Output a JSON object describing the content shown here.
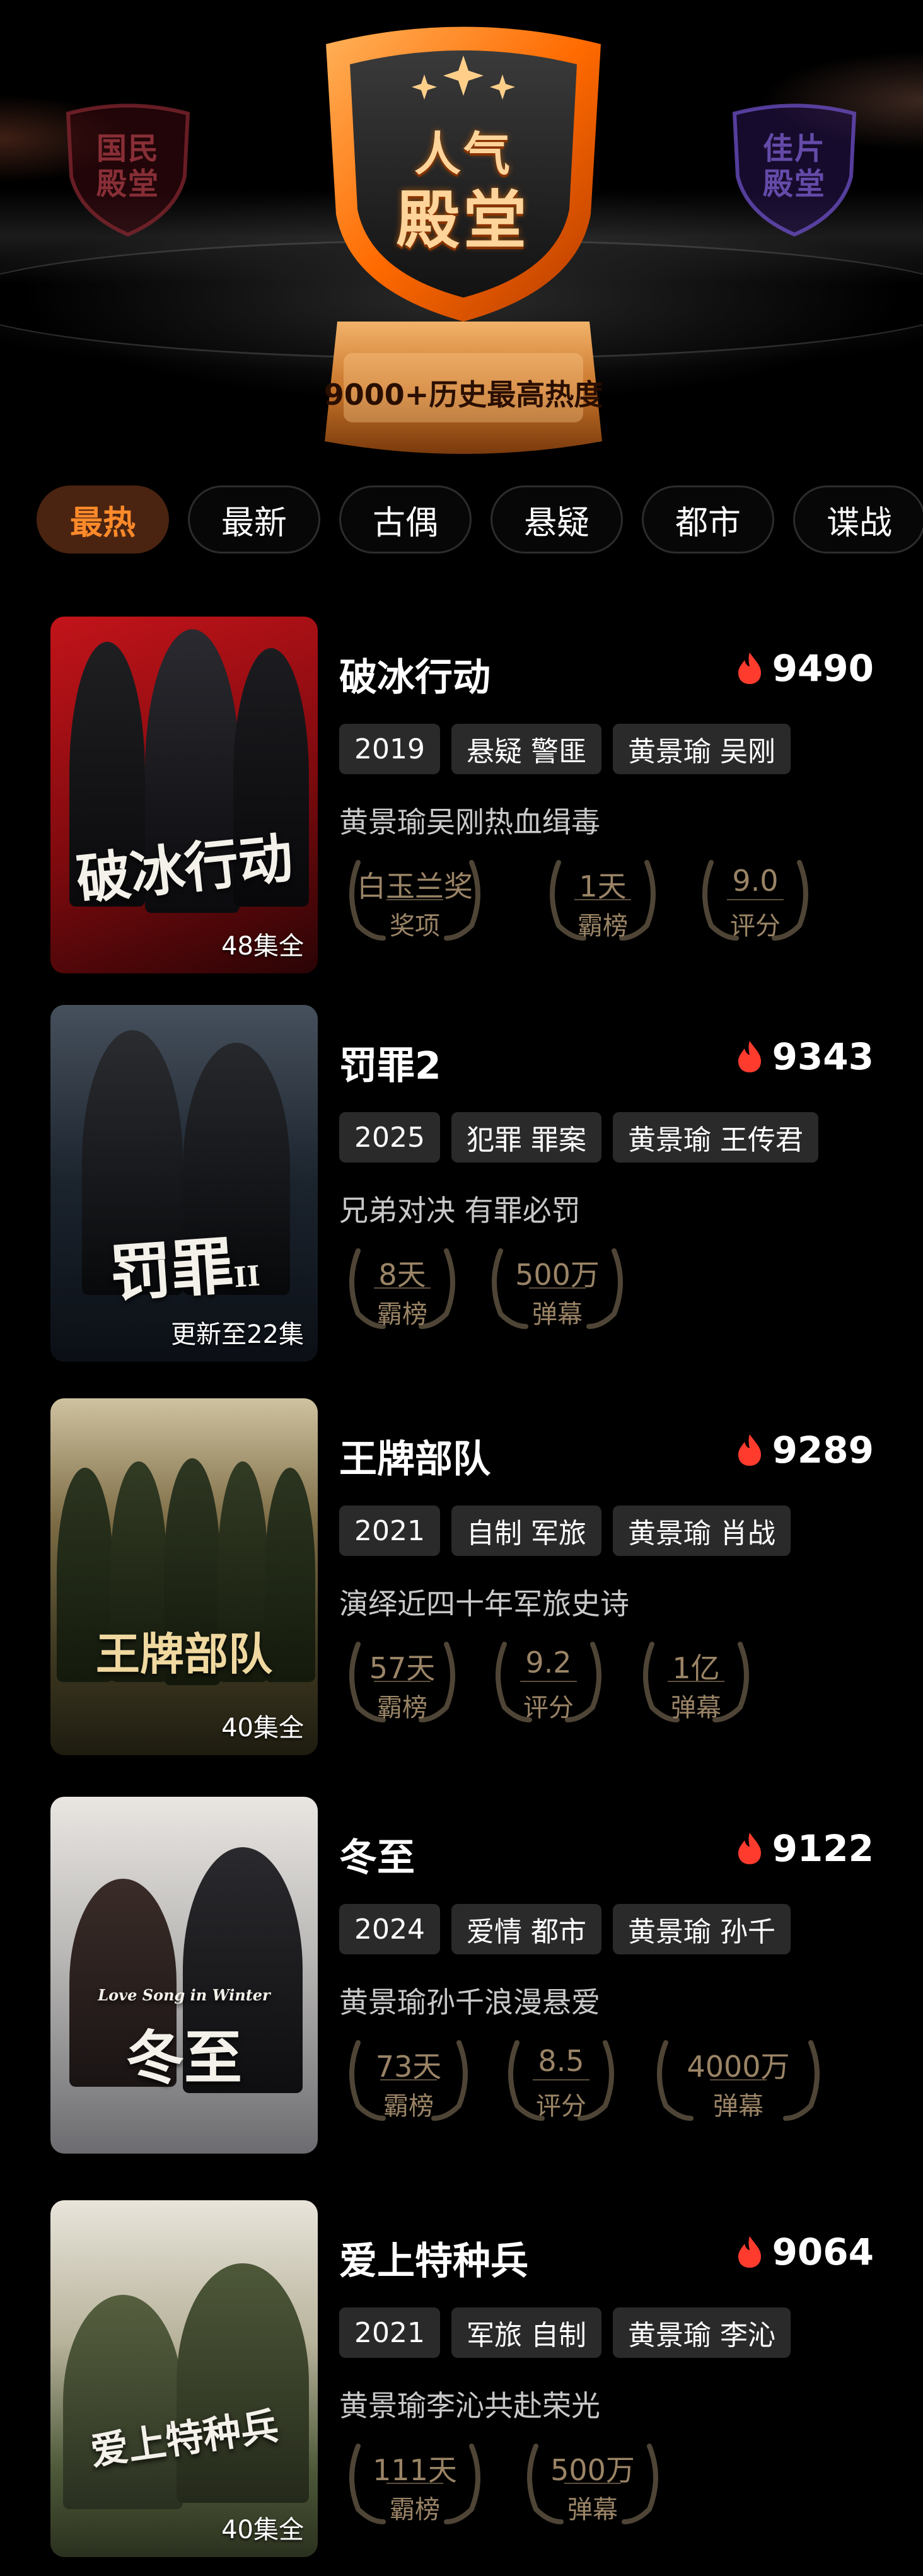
{
  "header": {
    "left_badge_text": [
      "国民",
      "殿堂"
    ],
    "main_badge_line1": "人气",
    "main_badge_line2": "殿堂",
    "main_badge_subtitle": "9000+历史最高热度",
    "right_badge_text": [
      "佳片",
      "殿堂"
    ],
    "accent_color": "#ff8a2a"
  },
  "tabs": [
    {
      "label": "最热",
      "active": true
    },
    {
      "label": "最新",
      "active": false
    },
    {
      "label": "古偶",
      "active": false
    },
    {
      "label": "悬疑",
      "active": false
    },
    {
      "label": "都市",
      "active": false
    },
    {
      "label": "谍战",
      "active": false
    }
  ],
  "shows": [
    {
      "title": "破冰行动",
      "heat": "9490",
      "poster_title": "破冰行动",
      "episodes": "48集全",
      "tags": [
        "2019",
        "悬疑 警匪",
        "黄景瑜 吴刚"
      ],
      "desc": "黄景瑜吴刚热血缉毒",
      "stats": [
        {
          "value": "白玉兰奖",
          "label": "奖项"
        },
        {
          "value": "1天",
          "label": "霸榜"
        },
        {
          "value": "9.0",
          "label": "评分"
        }
      ]
    },
    {
      "title": "罚罪2",
      "heat": "9343",
      "poster_title": "罚罪",
      "poster_mark": "II",
      "episodes": "更新至22集",
      "tags": [
        "2025",
        "犯罪 罪案",
        "黄景瑜 王传君"
      ],
      "desc": "兄弟对决 有罪必罚",
      "stats": [
        {
          "value": "8天",
          "label": "霸榜"
        },
        {
          "value": "500万",
          "label": "弹幕"
        }
      ]
    },
    {
      "title": "王牌部队",
      "heat": "9289",
      "poster_title": "王牌部队",
      "episodes": "40集全",
      "tags": [
        "2021",
        "自制 军旅",
        "黄景瑜 肖战"
      ],
      "desc": "演绎近四十年军旅史诗",
      "stats": [
        {
          "value": "57天",
          "label": "霸榜"
        },
        {
          "value": "9.2",
          "label": "评分"
        },
        {
          "value": "1亿",
          "label": "弹幕"
        }
      ]
    },
    {
      "title": "冬至",
      "heat": "9122",
      "poster_title": "冬至",
      "poster_en": "Love Song in Winter",
      "episodes": "",
      "tags": [
        "2024",
        "爱情 都市",
        "黄景瑜 孙千"
      ],
      "desc": "黄景瑜孙千浪漫悬爱",
      "stats": [
        {
          "value": "73天",
          "label": "霸榜"
        },
        {
          "value": "8.5",
          "label": "评分"
        },
        {
          "value": "4000万",
          "label": "弹幕"
        }
      ]
    },
    {
      "title": "爱上特种兵",
      "heat": "9064",
      "poster_title": "爱上特种兵",
      "episodes": "40集全",
      "tags": [
        "2021",
        "军旅 自制",
        "黄景瑜 李沁"
      ],
      "desc": "黄景瑜李沁共赴荣光",
      "stats": [
        {
          "value": "111天",
          "label": "霸榜"
        },
        {
          "value": "500万",
          "label": "弹幕"
        }
      ]
    }
  ]
}
